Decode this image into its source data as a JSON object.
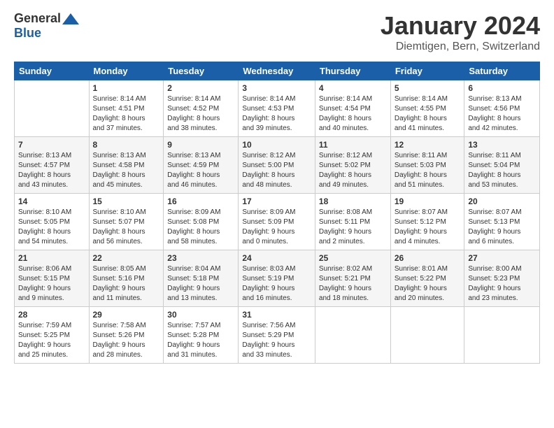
{
  "logo": {
    "general": "General",
    "blue": "Blue"
  },
  "title": "January 2024",
  "location": "Diemtigen, Bern, Switzerland",
  "days_header": [
    "Sunday",
    "Monday",
    "Tuesday",
    "Wednesday",
    "Thursday",
    "Friday",
    "Saturday"
  ],
  "weeks": [
    [
      {
        "num": "",
        "info": ""
      },
      {
        "num": "1",
        "info": "Sunrise: 8:14 AM\nSunset: 4:51 PM\nDaylight: 8 hours\nand 37 minutes."
      },
      {
        "num": "2",
        "info": "Sunrise: 8:14 AM\nSunset: 4:52 PM\nDaylight: 8 hours\nand 38 minutes."
      },
      {
        "num": "3",
        "info": "Sunrise: 8:14 AM\nSunset: 4:53 PM\nDaylight: 8 hours\nand 39 minutes."
      },
      {
        "num": "4",
        "info": "Sunrise: 8:14 AM\nSunset: 4:54 PM\nDaylight: 8 hours\nand 40 minutes."
      },
      {
        "num": "5",
        "info": "Sunrise: 8:14 AM\nSunset: 4:55 PM\nDaylight: 8 hours\nand 41 minutes."
      },
      {
        "num": "6",
        "info": "Sunrise: 8:13 AM\nSunset: 4:56 PM\nDaylight: 8 hours\nand 42 minutes."
      }
    ],
    [
      {
        "num": "7",
        "info": "Sunrise: 8:13 AM\nSunset: 4:57 PM\nDaylight: 8 hours\nand 43 minutes."
      },
      {
        "num": "8",
        "info": "Sunrise: 8:13 AM\nSunset: 4:58 PM\nDaylight: 8 hours\nand 45 minutes."
      },
      {
        "num": "9",
        "info": "Sunrise: 8:13 AM\nSunset: 4:59 PM\nDaylight: 8 hours\nand 46 minutes."
      },
      {
        "num": "10",
        "info": "Sunrise: 8:12 AM\nSunset: 5:00 PM\nDaylight: 8 hours\nand 48 minutes."
      },
      {
        "num": "11",
        "info": "Sunrise: 8:12 AM\nSunset: 5:02 PM\nDaylight: 8 hours\nand 49 minutes."
      },
      {
        "num": "12",
        "info": "Sunrise: 8:11 AM\nSunset: 5:03 PM\nDaylight: 8 hours\nand 51 minutes."
      },
      {
        "num": "13",
        "info": "Sunrise: 8:11 AM\nSunset: 5:04 PM\nDaylight: 8 hours\nand 53 minutes."
      }
    ],
    [
      {
        "num": "14",
        "info": "Sunrise: 8:10 AM\nSunset: 5:05 PM\nDaylight: 8 hours\nand 54 minutes."
      },
      {
        "num": "15",
        "info": "Sunrise: 8:10 AM\nSunset: 5:07 PM\nDaylight: 8 hours\nand 56 minutes."
      },
      {
        "num": "16",
        "info": "Sunrise: 8:09 AM\nSunset: 5:08 PM\nDaylight: 8 hours\nand 58 minutes."
      },
      {
        "num": "17",
        "info": "Sunrise: 8:09 AM\nSunset: 5:09 PM\nDaylight: 9 hours\nand 0 minutes."
      },
      {
        "num": "18",
        "info": "Sunrise: 8:08 AM\nSunset: 5:11 PM\nDaylight: 9 hours\nand 2 minutes."
      },
      {
        "num": "19",
        "info": "Sunrise: 8:07 AM\nSunset: 5:12 PM\nDaylight: 9 hours\nand 4 minutes."
      },
      {
        "num": "20",
        "info": "Sunrise: 8:07 AM\nSunset: 5:13 PM\nDaylight: 9 hours\nand 6 minutes."
      }
    ],
    [
      {
        "num": "21",
        "info": "Sunrise: 8:06 AM\nSunset: 5:15 PM\nDaylight: 9 hours\nand 9 minutes."
      },
      {
        "num": "22",
        "info": "Sunrise: 8:05 AM\nSunset: 5:16 PM\nDaylight: 9 hours\nand 11 minutes."
      },
      {
        "num": "23",
        "info": "Sunrise: 8:04 AM\nSunset: 5:18 PM\nDaylight: 9 hours\nand 13 minutes."
      },
      {
        "num": "24",
        "info": "Sunrise: 8:03 AM\nSunset: 5:19 PM\nDaylight: 9 hours\nand 16 minutes."
      },
      {
        "num": "25",
        "info": "Sunrise: 8:02 AM\nSunset: 5:21 PM\nDaylight: 9 hours\nand 18 minutes."
      },
      {
        "num": "26",
        "info": "Sunrise: 8:01 AM\nSunset: 5:22 PM\nDaylight: 9 hours\nand 20 minutes."
      },
      {
        "num": "27",
        "info": "Sunrise: 8:00 AM\nSunset: 5:23 PM\nDaylight: 9 hours\nand 23 minutes."
      }
    ],
    [
      {
        "num": "28",
        "info": "Sunrise: 7:59 AM\nSunset: 5:25 PM\nDaylight: 9 hours\nand 25 minutes."
      },
      {
        "num": "29",
        "info": "Sunrise: 7:58 AM\nSunset: 5:26 PM\nDaylight: 9 hours\nand 28 minutes."
      },
      {
        "num": "30",
        "info": "Sunrise: 7:57 AM\nSunset: 5:28 PM\nDaylight: 9 hours\nand 31 minutes."
      },
      {
        "num": "31",
        "info": "Sunrise: 7:56 AM\nSunset: 5:29 PM\nDaylight: 9 hours\nand 33 minutes."
      },
      {
        "num": "",
        "info": ""
      },
      {
        "num": "",
        "info": ""
      },
      {
        "num": "",
        "info": ""
      }
    ]
  ]
}
